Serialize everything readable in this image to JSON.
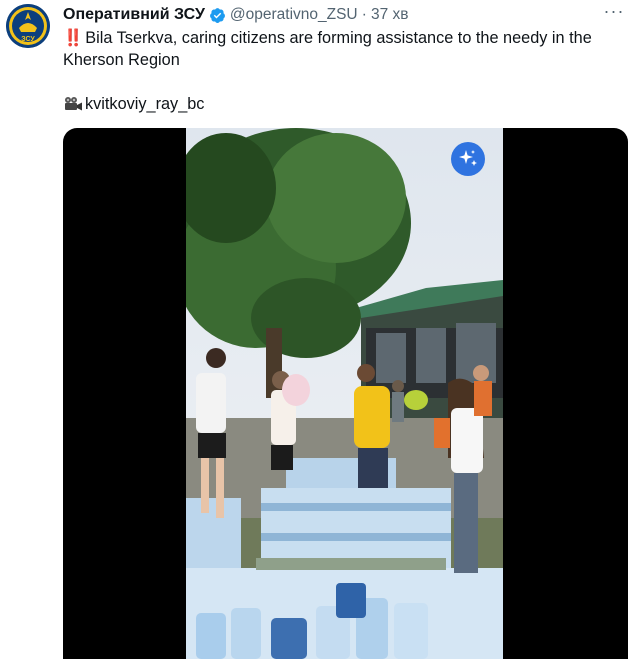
{
  "tweet": {
    "author_name": "Оперативний ЗСУ",
    "handle": "@operativno_ZSU",
    "separator": "·",
    "time": "37 хв",
    "more_label": "···",
    "emoji_prefix": "‼️",
    "text_line1": "Bila Tserkva, caring citizens are forming assistance to the needy in the",
    "text_line2": "Kherson Region",
    "credit_handle": "kvitkoviy_ray_bc",
    "avatar_text": "ЗСУ"
  },
  "icons": {
    "verified": "verified-badge-icon",
    "camera": "movie-camera-icon",
    "sparkle": "sparkle-icon",
    "more": "more-options-icon"
  },
  "colors": {
    "verified": "#1d9bf0",
    "sparkle_button": "#2f73e0",
    "text_secondary": "#536471"
  }
}
